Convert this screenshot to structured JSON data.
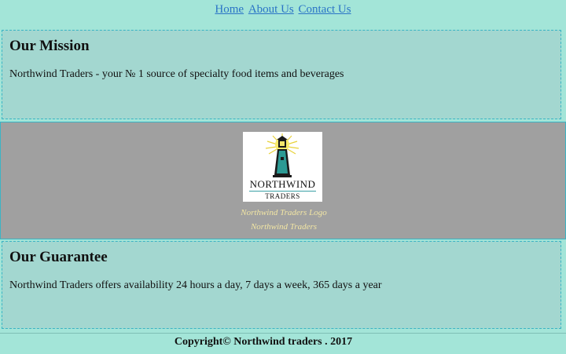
{
  "nav": {
    "home": "Home",
    "about": "About Us",
    "contact": "Contact Us"
  },
  "mission": {
    "title": "Our Mission",
    "text": "Northwind Traders - your № 1 source of specialty food items and beverages"
  },
  "logo": {
    "brand": "NORTHWIND",
    "sub": "TRADERS",
    "caption1": "Northwind Traders Logo",
    "caption2": "Northwind Traders"
  },
  "guarantee": {
    "title": "Our Guarantee",
    "text": "Northwind Traders offers availability 24 hours a day, 7 days a week, 365 days a year"
  },
  "footer": {
    "text": "Copyright© Northwind traders . 2017"
  },
  "colors": {
    "background": "#a3e5d8",
    "section_bg": "#a3d7d0",
    "logo_band": "#a0a0a0",
    "link": "#2a74c6",
    "caption": "#f2e6a4",
    "border": "#3ab4c4"
  }
}
